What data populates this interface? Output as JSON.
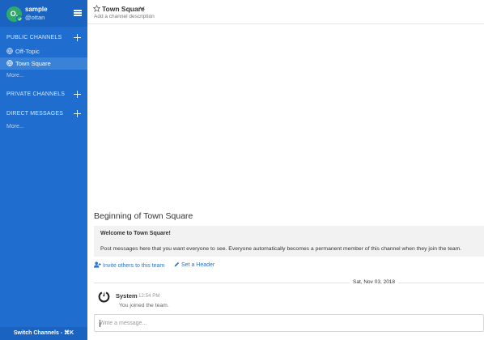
{
  "user": {
    "name": "sample",
    "handle": "@ottan",
    "avatar_initial": "O."
  },
  "sidebar": {
    "public_channels_title": "PUBLIC CHANNELS",
    "public_channels": [
      {
        "label": "Off-Topic",
        "icon": "globe-icon",
        "active": false
      },
      {
        "label": "Town Square",
        "icon": "globe-icon",
        "active": true
      }
    ],
    "public_more": "More...",
    "private_channels_title": "PRIVATE CHANNELS",
    "direct_messages_title": "DIRECT MESSAGES",
    "direct_more": "More...",
    "switch_channels": "Switch Channels - ⌘K"
  },
  "header": {
    "channel_name": "Town Square",
    "description_placeholder": "Add a channel description"
  },
  "intro": {
    "title": "Beginning of Town Square",
    "welcome": "Welcome to Town Square!",
    "post": "Post messages here that you want everyone to see. Everyone automatically becomes a permanent member of this channel when they join the team.",
    "invite_label": "Invite others to this team",
    "set_header_label": "Set a Header"
  },
  "feed": {
    "date_separator": "Sat, Nov 03, 2018",
    "posts": [
      {
        "author": "System",
        "time": "12:54 PM",
        "message": "You joined the team."
      }
    ]
  },
  "composer": {
    "placeholder": "Write a message..."
  },
  "colors": {
    "sidebar_bg": "#1e6dcf",
    "sidebar_header_bg": "#1a63c0",
    "active_channel_bg": "#3a82d8",
    "status_online": "#2eaa6b",
    "link": "#2a74d0"
  }
}
